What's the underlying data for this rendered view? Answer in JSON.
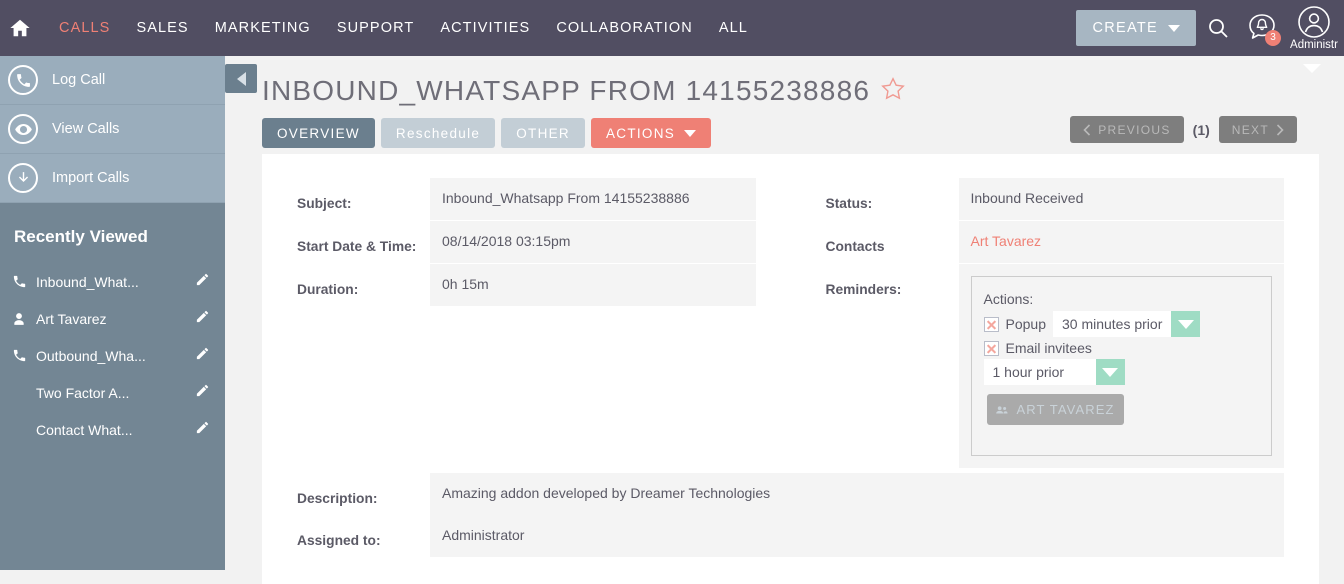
{
  "topnav": {
    "home_icon": "home-icon",
    "links": [
      {
        "label": "CALLS",
        "active": true
      },
      {
        "label": "SALES",
        "active": false
      },
      {
        "label": "MARKETING",
        "active": false
      },
      {
        "label": "SUPPORT",
        "active": false
      },
      {
        "label": "ACTIVITIES",
        "active": false
      },
      {
        "label": "COLLABORATION",
        "active": false
      },
      {
        "label": "ALL",
        "active": false
      }
    ],
    "create_label": "CREATE",
    "search_icon": "search-icon",
    "notifications_icon": "chat-bell-icon",
    "notifications_count": "3",
    "user_icon": "user-avatar-icon",
    "user_label": "Administr",
    "accent_color": "#ef8075",
    "bar_color": "#514e62"
  },
  "sidebar": {
    "actions": [
      {
        "label": "Log Call",
        "icon": "phone-icon"
      },
      {
        "label": "View Calls",
        "icon": "eye-icon"
      },
      {
        "label": "Import Calls",
        "icon": "download-arrow-icon"
      }
    ],
    "recent_title": "Recently Viewed",
    "recent_items": [
      {
        "label": "Inbound_What...",
        "icon": "phone-icon",
        "edit_icon": "pencil-icon"
      },
      {
        "label": "Art Tavarez",
        "icon": "person-icon",
        "edit_icon": "pencil-icon"
      },
      {
        "label": "Outbound_Wha...",
        "icon": "phone-icon",
        "edit_icon": "pencil-icon"
      },
      {
        "label": "Two Factor A...",
        "icon": "none",
        "edit_icon": "pencil-icon"
      },
      {
        "label": "Contact What...",
        "icon": "none",
        "edit_icon": "pencil-icon"
      }
    ]
  },
  "page": {
    "back_icon": "back-triangle-icon",
    "title": "INBOUND_WHATSAPP FROM 14155238886",
    "favorite_icon": "star-icon",
    "tabs": [
      {
        "label": "OVERVIEW",
        "state": "selected"
      },
      {
        "label": "Reschedule",
        "state": "unselected"
      },
      {
        "label": "OTHER",
        "state": "unselected"
      },
      {
        "label": "ACTIONS",
        "state": "action"
      }
    ],
    "pager": {
      "previous_label": "PREVIOUS",
      "page_label": "(1)",
      "next_label": "NEXT"
    }
  },
  "form": {
    "left": [
      {
        "label": "Subject:",
        "value": "Inbound_Whatsapp From 14155238886"
      },
      {
        "label": "Start Date & Time:",
        "value": "08/14/2018 03:15pm"
      },
      {
        "label": "Duration:",
        "value": "0h 15m"
      }
    ],
    "right": [
      {
        "label": "Status:",
        "value": "Inbound Received"
      },
      {
        "label": "Contacts",
        "value": "Art Tavarez",
        "is_link": true
      }
    ],
    "reminders_label": "Reminders:",
    "reminders": {
      "actions_label": "Actions:",
      "popup_label": "Popup",
      "popup_value": "30 minutes prior",
      "email_label": "Email invitees",
      "email_value": "1 hour prior",
      "invitee_button": "ART TAVAREZ",
      "invitee_icon": "people-icon",
      "dropdown_color": "#9fdcc4"
    },
    "bottom": [
      {
        "label": "Description:",
        "value": "Amazing addon developed by Dreamer Technologies"
      },
      {
        "label": "Assigned to:",
        "value": "Administrator"
      }
    ]
  }
}
